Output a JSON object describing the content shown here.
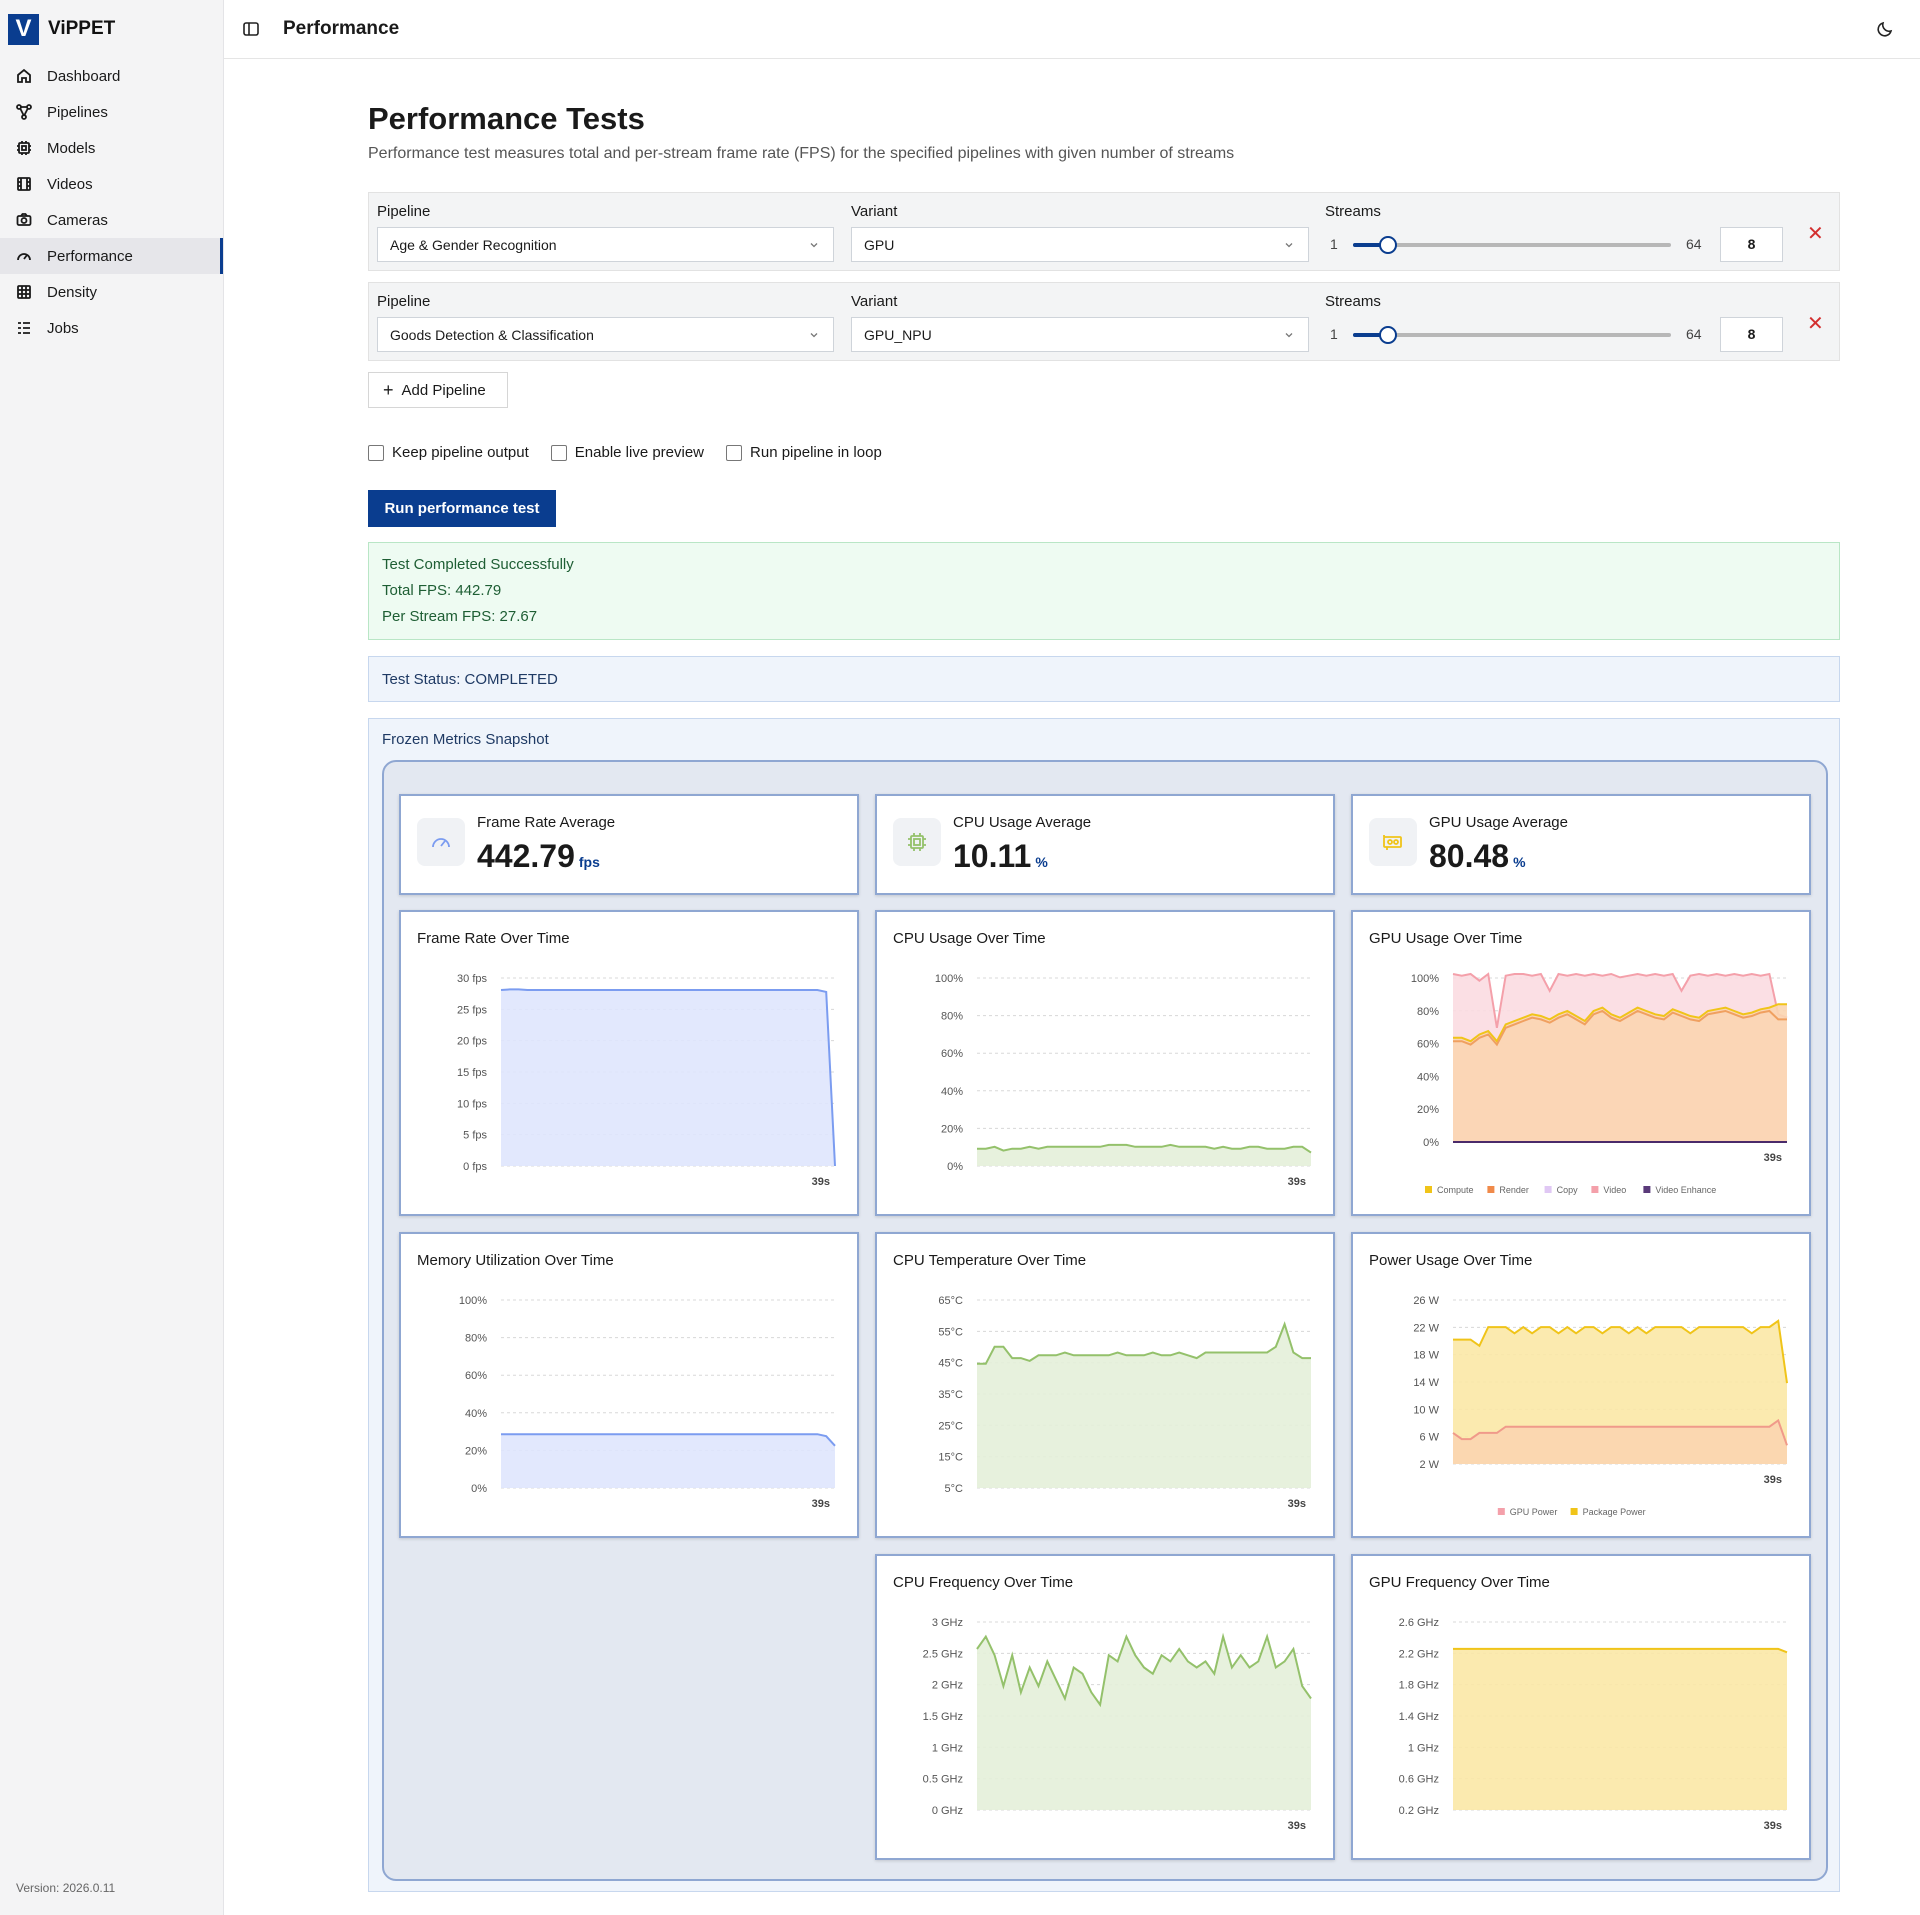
{
  "brand": {
    "logo_letter": "V",
    "name": "ViPPET"
  },
  "sidebar": {
    "items": [
      {
        "label": "Dashboard",
        "icon": "home-icon"
      },
      {
        "label": "Pipelines",
        "icon": "pipeline-icon"
      },
      {
        "label": "Models",
        "icon": "chip-icon"
      },
      {
        "label": "Videos",
        "icon": "film-icon"
      },
      {
        "label": "Cameras",
        "icon": "camera-icon"
      },
      {
        "label": "Performance",
        "icon": "gauge-icon",
        "active": true
      },
      {
        "label": "Density",
        "icon": "grid-icon"
      },
      {
        "label": "Jobs",
        "icon": "list-icon"
      }
    ],
    "version": "Version: 2026.0.11"
  },
  "header": {
    "title": "Performance"
  },
  "page": {
    "title": "Performance Tests",
    "description": "Performance test measures total and per-stream frame rate (FPS) for the specified pipelines with given number of streams"
  },
  "pipelines": [
    {
      "pipeline_label": "Pipeline",
      "pipeline": "Age & Gender Recognition",
      "variant_label": "Variant",
      "variant": "GPU",
      "streams_label": "Streams",
      "min": "1",
      "max": "64",
      "streams": "8",
      "remove": "✕"
    },
    {
      "pipeline_label": "Pipeline",
      "pipeline": "Goods Detection & Classification",
      "variant_label": "Variant",
      "variant": "GPU_NPU",
      "streams_label": "Streams",
      "min": "1",
      "max": "64",
      "streams": "8",
      "remove": "✕"
    }
  ],
  "slider": {
    "min": 1,
    "max": 64,
    "value": 8
  },
  "add_pipeline": {
    "label": "Add Pipeline",
    "icon": "plus-icon"
  },
  "options": {
    "keep_output": "Keep pipeline output",
    "live_preview": "Enable live preview",
    "run_loop": "Run pipeline in loop"
  },
  "run_button": "Run performance test",
  "result": {
    "title": "Test Completed Successfully",
    "total_fps": "Total FPS: 442.79",
    "per_stream_fps": "Per Stream FPS: 27.67"
  },
  "status": "Test Status: COMPLETED",
  "snapshot": {
    "title": "Frozen Metrics Snapshot",
    "stats": [
      {
        "label": "Frame Rate Average",
        "value": "442.79",
        "unit": "fps",
        "icon": "gauge-icon"
      },
      {
        "label": "CPU Usage Average",
        "value": "10.11",
        "unit": "%",
        "icon": "cpu-icon"
      },
      {
        "label": "GPU Usage Average",
        "value": "80.48",
        "unit": "%",
        "icon": "gpu-icon"
      }
    ]
  },
  "colors": {
    "accent": "#0a3d8f",
    "blue_line": "#7b9cf0",
    "blue_fill": "#dfe6fd",
    "green_line": "#94c16b",
    "green_fill": "#e4f0d9",
    "yellow_line": "#f0c419",
    "yellow_fill": "#fbe8a6",
    "orange_fill": "#fbd5b0",
    "pink_line": "#f4a0aa",
    "pink_fill": "#fbdbe1"
  },
  "chart_data": [
    {
      "type": "area",
      "title": "Frame Rate Over Time",
      "yticks": [
        "30 fps",
        "25 fps",
        "20 fps",
        "15 fps",
        "10 fps",
        "5 fps",
        "0 fps"
      ],
      "ylim": [
        0,
        30
      ],
      "x_end_label": "39s",
      "series": [
        {
          "values": [
            27.5,
            27.6,
            27.6,
            27.5,
            27.5,
            27.5,
            27.5,
            27.5,
            27.5,
            27.5,
            27.5,
            27.5,
            27.5,
            27.5,
            27.5,
            27.5,
            27.5,
            27.5,
            27.5,
            27.5,
            27.5,
            27.5,
            27.5,
            27.5,
            27.5,
            27.5,
            27.5,
            27.5,
            27.5,
            27.5,
            27.5,
            27.5,
            27.5,
            27.5,
            27.5,
            27.5,
            27.5,
            27.2,
            0
          ]
        }
      ]
    },
    {
      "type": "area",
      "title": "CPU Usage Over Time",
      "yticks": [
        "100%",
        "80%",
        "60%",
        "40%",
        "20%",
        "0%"
      ],
      "ylim": [
        0,
        100
      ],
      "x_end_label": "39s",
      "series": [
        {
          "values": [
            9,
            9,
            10,
            8,
            9,
            9,
            10,
            9,
            10,
            10,
            10,
            10,
            10,
            10,
            10,
            11,
            11,
            11,
            10,
            10,
            10,
            10,
            11,
            10,
            10,
            10,
            10,
            9,
            10,
            9,
            9,
            10,
            10,
            9,
            9,
            9,
            10,
            10,
            7
          ]
        }
      ]
    },
    {
      "type": "area",
      "title": "GPU Usage Over Time",
      "yticks": [
        "100%",
        "80%",
        "60%",
        "40%",
        "20%",
        "0%"
      ],
      "ylim": [
        0,
        100
      ],
      "x_end_label": "39s",
      "legend": [
        "Compute",
        "Render",
        "Copy",
        "Video",
        "Video Enhance"
      ],
      "series": [
        {
          "name": "Compute",
          "values": [
            62,
            62,
            60,
            64,
            66,
            60,
            70,
            72,
            74,
            76,
            75,
            73,
            76,
            78,
            75,
            72,
            78,
            80,
            76,
            74,
            77,
            80,
            78,
            76,
            75,
            79,
            77,
            75,
            74,
            78,
            79,
            80,
            78,
            76,
            77,
            79,
            80,
            82,
            82
          ]
        },
        {
          "name": "Render",
          "values": [
            60,
            60,
            58,
            62,
            64,
            58,
            68,
            70,
            72,
            74,
            73,
            71,
            74,
            76,
            73,
            70,
            76,
            78,
            74,
            72,
            75,
            78,
            76,
            74,
            73,
            77,
            75,
            73,
            72,
            76,
            77,
            78,
            76,
            74,
            75,
            77,
            78,
            73,
            73
          ]
        },
        {
          "name": "Copy",
          "values": [
            0,
            0,
            0,
            0,
            0,
            0,
            0,
            0,
            0,
            0,
            0,
            0,
            0,
            0,
            0,
            0,
            0,
            0,
            0,
            0,
            0,
            0,
            0,
            0,
            0,
            0,
            0,
            0,
            0,
            0,
            0,
            0,
            0,
            0,
            0,
            0,
            0,
            0,
            0
          ]
        },
        {
          "name": "Video",
          "values": [
            100,
            99,
            100,
            96,
            100,
            68,
            99,
            100,
            100,
            99,
            100,
            90,
            100,
            99,
            100,
            99,
            100,
            99,
            100,
            98,
            99,
            100,
            99,
            100,
            99,
            100,
            90,
            99,
            100,
            99,
            100,
            99,
            100,
            99,
            100,
            99,
            100,
            76,
            74
          ]
        },
        {
          "name": "Video Enhance",
          "values": [
            0,
            0,
            0,
            0,
            0,
            0,
            0,
            0,
            0,
            0,
            0,
            0,
            0,
            0,
            0,
            0,
            0,
            0,
            0,
            0,
            0,
            0,
            0,
            0,
            0,
            0,
            0,
            0,
            0,
            0,
            0,
            0,
            0,
            0,
            0,
            0,
            0,
            0,
            0
          ]
        }
      ]
    },
    {
      "type": "area",
      "title": "Memory Utilization Over Time",
      "yticks": [
        "100%",
        "80%",
        "60%",
        "40%",
        "20%",
        "0%"
      ],
      "ylim": [
        0,
        100
      ],
      "x_end_label": "39s",
      "series": [
        {
          "values": [
            28,
            28,
            28,
            28,
            28,
            28,
            28,
            28,
            28,
            28,
            28,
            28,
            28,
            28,
            28,
            28,
            28,
            28,
            28,
            28,
            28,
            28,
            28,
            28,
            28,
            28,
            28,
            28,
            28,
            28,
            28,
            28,
            28,
            28,
            28,
            28,
            28,
            27,
            22
          ]
        }
      ]
    },
    {
      "type": "area",
      "title": "CPU Temperature Over Time",
      "yticks": [
        "65°C",
        "55°C",
        "45°C",
        "35°C",
        "25°C",
        "15°C",
        "5°C"
      ],
      "ylim": [
        0,
        68
      ],
      "x_end_label": "39s",
      "series": [
        {
          "values": [
            44,
            44,
            50,
            50,
            46,
            46,
            45,
            47,
            47,
            47,
            48,
            47,
            47,
            47,
            47,
            47,
            48,
            47,
            47,
            47,
            48,
            47,
            47,
            48,
            47,
            46,
            48,
            48,
            48,
            48,
            48,
            48,
            48,
            48,
            50,
            58,
            48,
            46,
            46
          ]
        }
      ]
    },
    {
      "type": "area",
      "title": "Power Usage Over Time",
      "yticks": [
        "26 W",
        "22 W",
        "18 W",
        "14 W",
        "10 W",
        "6 W",
        "2 W"
      ],
      "ylim": [
        0,
        27
      ],
      "x_end_label": "39s",
      "legend": [
        "GPU Power",
        "Package Power"
      ],
      "series": [
        {
          "name": "Package Power",
          "values": [
            20,
            20,
            20,
            19,
            22,
            22,
            22,
            21,
            22,
            21,
            22,
            22,
            21,
            22,
            21,
            22,
            22,
            21,
            22,
            22,
            21,
            22,
            21,
            22,
            22,
            22,
            22,
            21,
            22,
            22,
            22,
            22,
            22,
            22,
            21,
            22,
            22,
            23,
            13
          ]
        },
        {
          "name": "GPU Power",
          "values": [
            5,
            4,
            4,
            5,
            5,
            5,
            6,
            6,
            6,
            6,
            6,
            6,
            6,
            6,
            6,
            6,
            6,
            6,
            6,
            6,
            6,
            6,
            6,
            6,
            6,
            6,
            6,
            6,
            6,
            6,
            6,
            6,
            6,
            6,
            6,
            6,
            6,
            7,
            3
          ]
        }
      ]
    },
    {
      "type": "area",
      "title": "CPU Frequency Over Time",
      "yticks": [
        "3 GHz",
        "2.5 GHz",
        "2 GHz",
        "1.5 GHz",
        "1 GHz",
        "0.5 GHz",
        "0 GHz"
      ],
      "ylim": [
        0,
        3.1
      ],
      "x_end_label": "39s",
      "series": [
        {
          "values": [
            2.6,
            2.8,
            2.5,
            2.0,
            2.5,
            1.9,
            2.3,
            2.0,
            2.4,
            2.1,
            1.8,
            2.3,
            2.2,
            1.9,
            1.7,
            2.5,
            2.4,
            2.8,
            2.5,
            2.3,
            2.2,
            2.5,
            2.4,
            2.6,
            2.4,
            2.3,
            2.4,
            2.2,
            2.8,
            2.3,
            2.5,
            2.3,
            2.4,
            2.8,
            2.3,
            2.4,
            2.6,
            2.0,
            1.8
          ]
        }
      ]
    },
    {
      "type": "area",
      "title": "GPU Frequency Over Time",
      "yticks": [
        "2.6 GHz",
        "2.2 GHz",
        "1.8 GHz",
        "1.4 GHz",
        "1 GHz",
        "0.6 GHz",
        "0.2 GHz"
      ],
      "ylim": [
        0,
        2.8
      ],
      "x_end_label": "39s",
      "series": [
        {
          "values": [
            2.35,
            2.35,
            2.35,
            2.35,
            2.35,
            2.35,
            2.35,
            2.35,
            2.35,
            2.35,
            2.35,
            2.35,
            2.35,
            2.35,
            2.35,
            2.35,
            2.35,
            2.35,
            2.35,
            2.35,
            2.35,
            2.35,
            2.35,
            2.35,
            2.35,
            2.35,
            2.35,
            2.35,
            2.35,
            2.35,
            2.35,
            2.35,
            2.35,
            2.35,
            2.35,
            2.35,
            2.35,
            2.35,
            2.3
          ]
        }
      ]
    }
  ]
}
